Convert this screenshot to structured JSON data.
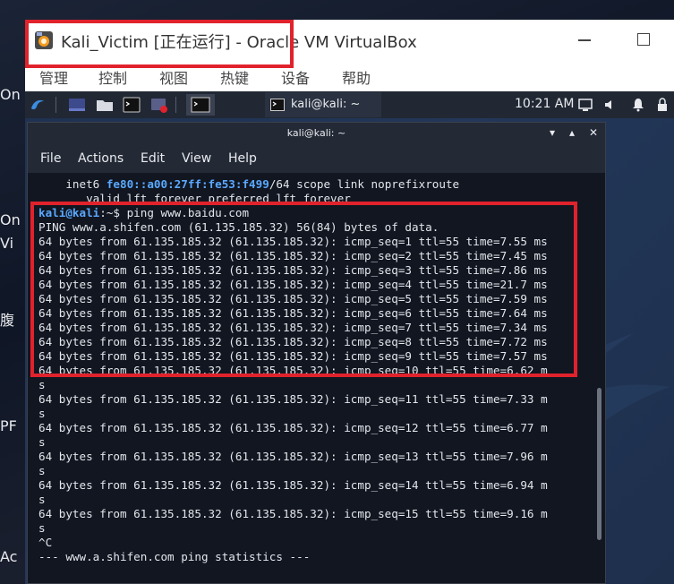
{
  "host": {
    "side_labels": [
      "On",
      "Vi",
      "腹",
      "PF",
      "Ac"
    ]
  },
  "vbox": {
    "title": "Kali_Victim [正在运行] - Oracle VM VirtualBox",
    "menu": [
      "管理",
      "控制",
      "视图",
      "热键",
      "设备",
      "帮助"
    ]
  },
  "kali_panel": {
    "terminal_tab_label": "kali@kali: ~",
    "clock": "10:21 AM"
  },
  "terminal": {
    "title": "kali@kali: ~",
    "menu": [
      "File",
      "Actions",
      "Edit",
      "View",
      "Help"
    ],
    "lines": [
      {
        "kind": "inet6",
        "prefix": "    inet6 ",
        "addr": "fe80::a00:27ff:fe53:f499",
        "suffix": "/64 scope link noprefixroute"
      },
      {
        "kind": "plain",
        "text": "       valid_lft forever preferred_lft forever"
      },
      {
        "kind": "prompt",
        "user": "kali@kali",
        "rest": ":~$ ping www.baidu.com"
      },
      {
        "kind": "plain",
        "text": "PING www.a.shifen.com (61.135.185.32) 56(84) bytes of data."
      },
      {
        "kind": "plain",
        "text": "64 bytes from 61.135.185.32 (61.135.185.32): icmp_seq=1 ttl=55 time=7.55 ms"
      },
      {
        "kind": "plain",
        "text": "64 bytes from 61.135.185.32 (61.135.185.32): icmp_seq=2 ttl=55 time=7.45 ms"
      },
      {
        "kind": "plain",
        "text": "64 bytes from 61.135.185.32 (61.135.185.32): icmp_seq=3 ttl=55 time=7.86 ms"
      },
      {
        "kind": "plain",
        "text": "64 bytes from 61.135.185.32 (61.135.185.32): icmp_seq=4 ttl=55 time=21.7 ms"
      },
      {
        "kind": "plain",
        "text": "64 bytes from 61.135.185.32 (61.135.185.32): icmp_seq=5 ttl=55 time=7.59 ms"
      },
      {
        "kind": "plain",
        "text": "64 bytes from 61.135.185.32 (61.135.185.32): icmp_seq=6 ttl=55 time=7.64 ms"
      },
      {
        "kind": "plain",
        "text": "64 bytes from 61.135.185.32 (61.135.185.32): icmp_seq=7 ttl=55 time=7.34 ms"
      },
      {
        "kind": "plain",
        "text": "64 bytes from 61.135.185.32 (61.135.185.32): icmp_seq=8 ttl=55 time=7.72 ms"
      },
      {
        "kind": "plain",
        "text": "64 bytes from 61.135.185.32 (61.135.185.32): icmp_seq=9 ttl=55 time=7.57 ms"
      },
      {
        "kind": "plain",
        "text": "64 bytes from 61.135.185.32 (61.135.185.32): icmp_seq=10 ttl=55 time=6.62 m"
      },
      {
        "kind": "plain",
        "text": "s"
      },
      {
        "kind": "plain",
        "text": "64 bytes from 61.135.185.32 (61.135.185.32): icmp_seq=11 ttl=55 time=7.33 m"
      },
      {
        "kind": "plain",
        "text": "s"
      },
      {
        "kind": "plain",
        "text": "64 bytes from 61.135.185.32 (61.135.185.32): icmp_seq=12 ttl=55 time=6.77 m"
      },
      {
        "kind": "plain",
        "text": "s"
      },
      {
        "kind": "plain",
        "text": "64 bytes from 61.135.185.32 (61.135.185.32): icmp_seq=13 ttl=55 time=7.96 m"
      },
      {
        "kind": "plain",
        "text": "s"
      },
      {
        "kind": "plain",
        "text": "64 bytes from 61.135.185.32 (61.135.185.32): icmp_seq=14 ttl=55 time=6.94 m"
      },
      {
        "kind": "plain",
        "text": "s"
      },
      {
        "kind": "plain",
        "text": "64 bytes from 61.135.185.32 (61.135.185.32): icmp_seq=15 ttl=55 time=9.16 m"
      },
      {
        "kind": "plain",
        "text": "s"
      },
      {
        "kind": "plain",
        "text": "^C"
      },
      {
        "kind": "plain",
        "text": "--- www.a.shifen.com ping statistics ---"
      }
    ]
  },
  "colors": {
    "highlight": "#e0222c",
    "prompt_blue": "#5aa9ff",
    "terminal_bg": "#111621"
  }
}
